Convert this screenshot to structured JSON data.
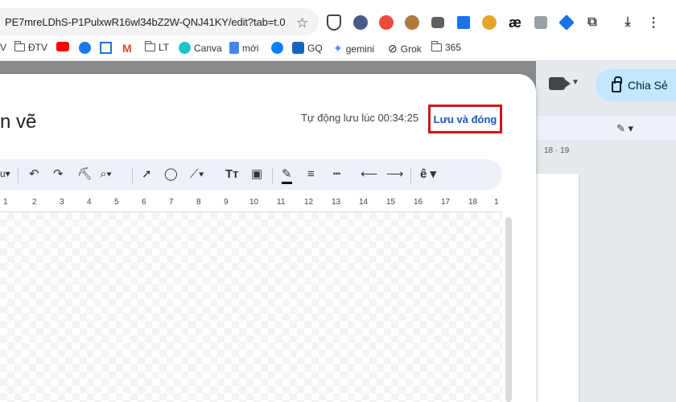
{
  "browser": {
    "url": "PE7mreLDhS-P1PulxwR16wl34bZ2W-QNJ41KY/edit?tab=t.0",
    "extensions": [
      "a-icon",
      "reader-icon",
      "cookie-icon",
      "youtube-ext-icon",
      "download-icon",
      "gear-flower-icon",
      "ae-icon",
      "code-icon",
      "tag-icon",
      "puzzle-icon"
    ],
    "bookmarks": [
      {
        "label": "V",
        "icon": "none"
      },
      {
        "label": "ĐTV",
        "icon": "folder-icon"
      },
      {
        "label": "",
        "icon": "youtube-icon"
      },
      {
        "label": "",
        "icon": "facebook-icon"
      },
      {
        "label": "",
        "icon": "calendar-icon"
      },
      {
        "label": "",
        "icon": "gmail-icon"
      },
      {
        "label": "LT",
        "icon": "folder-icon"
      },
      {
        "label": "Canva",
        "icon": "canva-icon"
      },
      {
        "label": "mới",
        "icon": "docs-icon"
      },
      {
        "label": "",
        "icon": "messenger-icon"
      },
      {
        "label": "GQ",
        "icon": "gq-icon"
      },
      {
        "label": "gemini",
        "icon": "gemini-icon"
      },
      {
        "label": "Grok",
        "icon": "grok-icon"
      },
      {
        "label": "365",
        "icon": "folder-icon"
      }
    ]
  },
  "docs": {
    "share_label": "Chia Sẻ",
    "ruler_labels": "18 · 19"
  },
  "dialog": {
    "title": "n vẽ",
    "autosave_text": "Tự động lưu lúc 00:34:25",
    "save_close_label": "Lưu và đóng",
    "ruler_ticks": [
      "1",
      "2",
      "3",
      "4",
      "5",
      "6",
      "7",
      "8",
      "9",
      "10",
      "11",
      "12",
      "13",
      "14",
      "15",
      "16",
      "17",
      "18",
      "1"
    ]
  },
  "colors": {
    "accent": "#1a56c4",
    "highlight_box": "#d6111a",
    "toolbar_bg": "#edf2fa",
    "share_bg": "#c2e7ff"
  }
}
